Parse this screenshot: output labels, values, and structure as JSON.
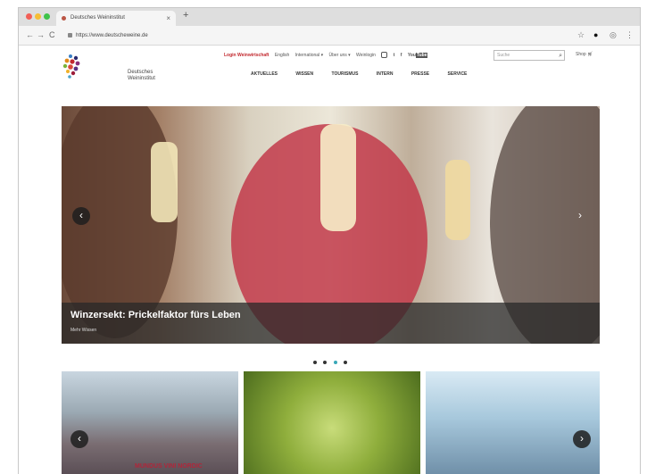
{
  "browser": {
    "tab_title": "Deutsches Weininstitut",
    "tab_close": "×",
    "new_tab": "+",
    "url": "https://www.deutscheweine.de",
    "back": "←",
    "forward": "→",
    "reload": "C",
    "star": "☆",
    "ext": "●",
    "profile": "◎",
    "menu": "⋮"
  },
  "site": {
    "logo": {
      "line1": "Deutsches",
      "line2": "Weininstitut"
    },
    "util_nav": {
      "login": "Login Weinwirtschaft",
      "english": "English",
      "international": "International ▾",
      "ueber_uns": "Über uns ▾",
      "weinlogin": "Weinlogin",
      "search_placeholder": "Suche",
      "shop": "Shop"
    },
    "main_nav": [
      "AKTUELLES",
      "WISSEN",
      "TOURISMUS",
      "INTERN",
      "PRESSE",
      "SERVICE"
    ],
    "hero": {
      "title": "Winzersekt: Prickelfaktor fürs Leben",
      "more": "Mehr Wissen"
    },
    "tiles": [
      {
        "caption": "MUNDUS VINI NORDIC"
      }
    ],
    "carousel_dots": 4,
    "active_dot": 2,
    "colors": {
      "accent": "#39a8b8",
      "brand_red": "#c2272d"
    }
  }
}
